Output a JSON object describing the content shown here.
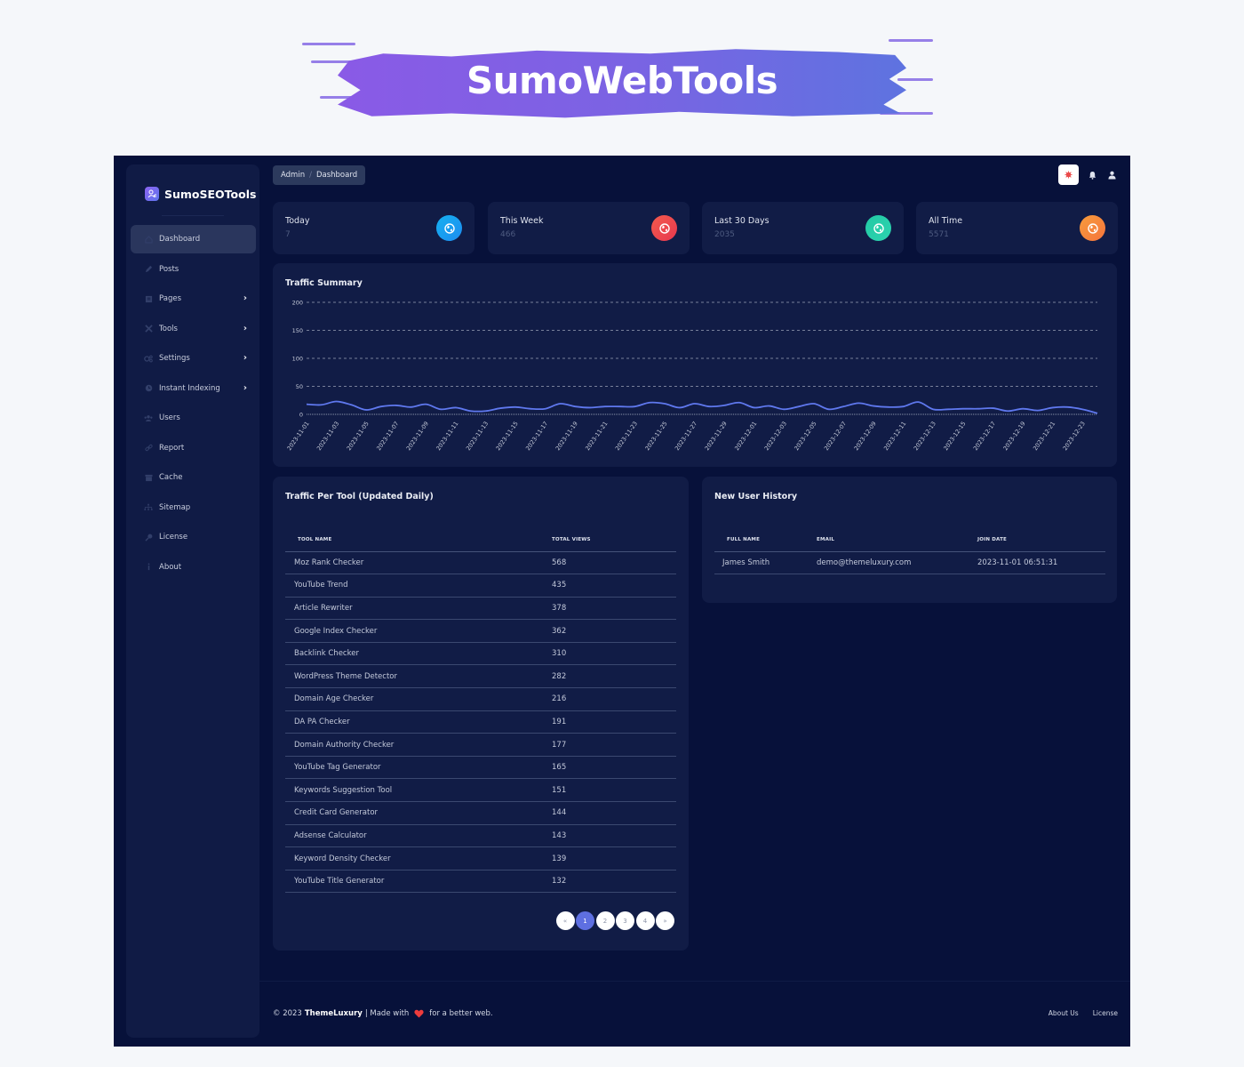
{
  "banner": {
    "title": "SumoWebTools"
  },
  "brand": {
    "name": "SumoSEOTools",
    "logo_icon": "user-chart-icon"
  },
  "sidebar": {
    "items": [
      {
        "label": "Dashboard",
        "icon": "home-icon",
        "active": true,
        "has_submenu": false
      },
      {
        "label": "Posts",
        "icon": "pencil-icon",
        "active": false,
        "has_submenu": false
      },
      {
        "label": "Pages",
        "icon": "page-icon",
        "active": false,
        "has_submenu": true
      },
      {
        "label": "Tools",
        "icon": "tools-icon",
        "active": false,
        "has_submenu": true
      },
      {
        "label": "Settings",
        "icon": "gears-icon",
        "active": false,
        "has_submenu": true
      },
      {
        "label": "Instant Indexing",
        "icon": "clock-icon",
        "active": false,
        "has_submenu": true
      },
      {
        "label": "Users",
        "icon": "users-icon",
        "active": false,
        "has_submenu": false
      },
      {
        "label": "Report",
        "icon": "link-icon",
        "active": false,
        "has_submenu": false
      },
      {
        "label": "Cache",
        "icon": "archive-icon",
        "active": false,
        "has_submenu": false
      },
      {
        "label": "Sitemap",
        "icon": "sitemap-icon",
        "active": false,
        "has_submenu": false
      },
      {
        "label": "License",
        "icon": "key-icon",
        "active": false,
        "has_submenu": false
      },
      {
        "label": "About",
        "icon": "info-icon",
        "active": false,
        "has_submenu": false
      }
    ],
    "chevron": "›"
  },
  "header": {
    "breadcrumb": [
      "Admin",
      "Dashboard"
    ],
    "breadcrumb_sep": "/"
  },
  "stats": [
    {
      "title": "Today",
      "value": "7",
      "color_from": "#15b0f0",
      "color_to": "#1d8cf0"
    },
    {
      "title": "This Week",
      "value": "466",
      "color_from": "#f25a4c",
      "color_to": "#e8384f"
    },
    {
      "title": "Last 30 Days",
      "value": "2035",
      "color_from": "#22c9a4",
      "color_to": "#2dd3b0"
    },
    {
      "title": "All Time",
      "value": "5571",
      "color_from": "#f79c3b",
      "color_to": "#f5743d"
    }
  ],
  "traffic_summary": {
    "title": "Traffic Summary"
  },
  "chart_data": {
    "type": "line",
    "title": "Traffic Summary",
    "xlabel": "",
    "ylabel": "",
    "ylim": [
      0,
      200
    ],
    "yticks": [
      0,
      50,
      100,
      150,
      200
    ],
    "grid": true,
    "legend": "none",
    "line_color": "#5f78ee",
    "x": [
      "2023-11-01",
      "2023-11-02",
      "2023-11-03",
      "2023-11-04",
      "2023-11-05",
      "2023-11-06",
      "2023-11-07",
      "2023-11-08",
      "2023-11-09",
      "2023-11-10",
      "2023-11-11",
      "2023-11-12",
      "2023-11-13",
      "2023-11-14",
      "2023-11-15",
      "2023-11-16",
      "2023-11-17",
      "2023-11-18",
      "2023-11-19",
      "2023-11-20",
      "2023-11-21",
      "2023-11-22",
      "2023-11-23",
      "2023-11-24",
      "2023-11-25",
      "2023-11-26",
      "2023-11-27",
      "2023-11-28",
      "2023-11-29",
      "2023-11-30",
      "2023-12-01",
      "2023-12-02",
      "2023-12-03",
      "2023-12-04",
      "2023-12-05",
      "2023-12-06",
      "2023-12-07",
      "2023-12-08",
      "2023-12-09",
      "2023-12-10",
      "2023-12-11",
      "2023-12-12",
      "2023-12-13",
      "2023-12-14",
      "2023-12-15",
      "2023-12-16",
      "2023-12-17",
      "2023-12-18",
      "2023-12-19",
      "2023-12-20",
      "2023-12-21",
      "2023-12-22",
      "2023-12-23",
      "2023-12-24"
    ],
    "xtick_labels": [
      "2023-11-01",
      "2023-11-03",
      "2023-11-05",
      "2023-11-07",
      "2023-11-09",
      "2023-11-11",
      "2023-11-13",
      "2023-11-15",
      "2023-11-17",
      "2023-11-19",
      "2023-11-21",
      "2023-11-23",
      "2023-11-25",
      "2023-11-27",
      "2023-11-29",
      "2023-12-01",
      "2023-12-03",
      "2023-12-05",
      "2023-12-07",
      "2023-12-09",
      "2023-12-11",
      "2023-12-13",
      "2023-12-15",
      "2023-12-17",
      "2023-12-19",
      "2023-12-21",
      "2023-12-23"
    ],
    "series": [
      {
        "name": "Traffic",
        "values": [
          18,
          17,
          23,
          17,
          8,
          14,
          16,
          13,
          18,
          9,
          12,
          6,
          6,
          11,
          13,
          10,
          10,
          19,
          14,
          12,
          14,
          14,
          14,
          21,
          19,
          12,
          19,
          14,
          16,
          21,
          12,
          15,
          9,
          14,
          19,
          9,
          14,
          20,
          15,
          13,
          14,
          22,
          9,
          9,
          10,
          10,
          11,
          6,
          10,
          7,
          12,
          13,
          9,
          2
        ]
      }
    ]
  },
  "traffic_per_tool": {
    "title": "Traffic Per Tool (Updated Daily)",
    "columns": [
      "TOOL NAME",
      "TOTAL VIEWS"
    ],
    "rows": [
      [
        "Moz Rank Checker",
        "568"
      ],
      [
        "YouTube Trend",
        "435"
      ],
      [
        "Article Rewriter",
        "378"
      ],
      [
        "Google Index Checker",
        "362"
      ],
      [
        "Backlink Checker",
        "310"
      ],
      [
        "WordPress Theme Detector",
        "282"
      ],
      [
        "Domain Age Checker",
        "216"
      ],
      [
        "DA PA Checker",
        "191"
      ],
      [
        "Domain Authority Checker",
        "177"
      ],
      [
        "YouTube Tag Generator",
        "165"
      ],
      [
        "Keywords Suggestion Tool",
        "151"
      ],
      [
        "Credit Card Generator",
        "144"
      ],
      [
        "Adsense Calculator",
        "143"
      ],
      [
        "Keyword Density Checker",
        "139"
      ],
      [
        "YouTube Title Generator",
        "132"
      ]
    ],
    "pagination": {
      "prev": "«",
      "next": "»",
      "pages": [
        "1",
        "2",
        "3",
        "4"
      ],
      "current": "1"
    }
  },
  "new_users": {
    "title": "New User History",
    "columns": [
      "FULL NAME",
      "EMAIL",
      "JOIN DATE"
    ],
    "rows": [
      [
        "James Smith",
        "demo@themeluxury.com",
        "2023-11-01 06:51:31"
      ]
    ]
  },
  "footer": {
    "copyright": "© 2023",
    "company": "ThemeLuxury",
    "made_with": "| Made with",
    "tail": "for a better web.",
    "links": [
      "About Us",
      "License"
    ]
  }
}
